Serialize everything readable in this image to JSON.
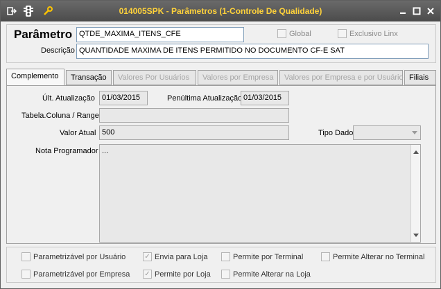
{
  "window": {
    "title": "014005SPK - Parâmetros (1-Controle De Qualidade)"
  },
  "header": {
    "parametro_label": "Parâmetro",
    "parametro_value": "QTDE_MAXIMA_ITENS_CFE",
    "global_label": "Global",
    "exclusivo_label": "Exclusivo Linx",
    "descricao_label": "Descrição",
    "descricao_value": "QUANTIDADE MAXIMA DE ITENS PERMITIDO NO DOCUMENTO CF-E SAT"
  },
  "tabs": [
    {
      "label": "Complemento"
    },
    {
      "label": "Transação"
    },
    {
      "label": "Valores Por Usuários"
    },
    {
      "label": "Valores por Empresa"
    },
    {
      "label": "Valores por Empresa e por Usuário"
    },
    {
      "label": "Filiais"
    }
  ],
  "complemento": {
    "ult_atualizacao_label": "Últ. Atualização",
    "ult_atualizacao_value": "01/03/2015",
    "penultima_label": "Penúltima Atualização",
    "penultima_value": "01/03/2015",
    "tabela_label": "Tabela.Coluna / Range",
    "tabela_value": "",
    "valor_atual_label": "Valor Atual",
    "valor_atual_value": "500",
    "tipo_dado_label": "Tipo Dado",
    "tipo_dado_value": "",
    "nota_label": "Nota Programador",
    "nota_value": "..."
  },
  "options": {
    "param_usuario": "Parametrizável por Usuário",
    "envia_loja": "Envia para Loja",
    "permite_terminal": "Permite por Terminal",
    "alterar_terminal": "Permite Alterar no Terminal",
    "param_empresa": "Parametrizável por Empresa",
    "permite_loja": "Permite por Loja",
    "alterar_loja": "Permite Alterar na Loja"
  }
}
